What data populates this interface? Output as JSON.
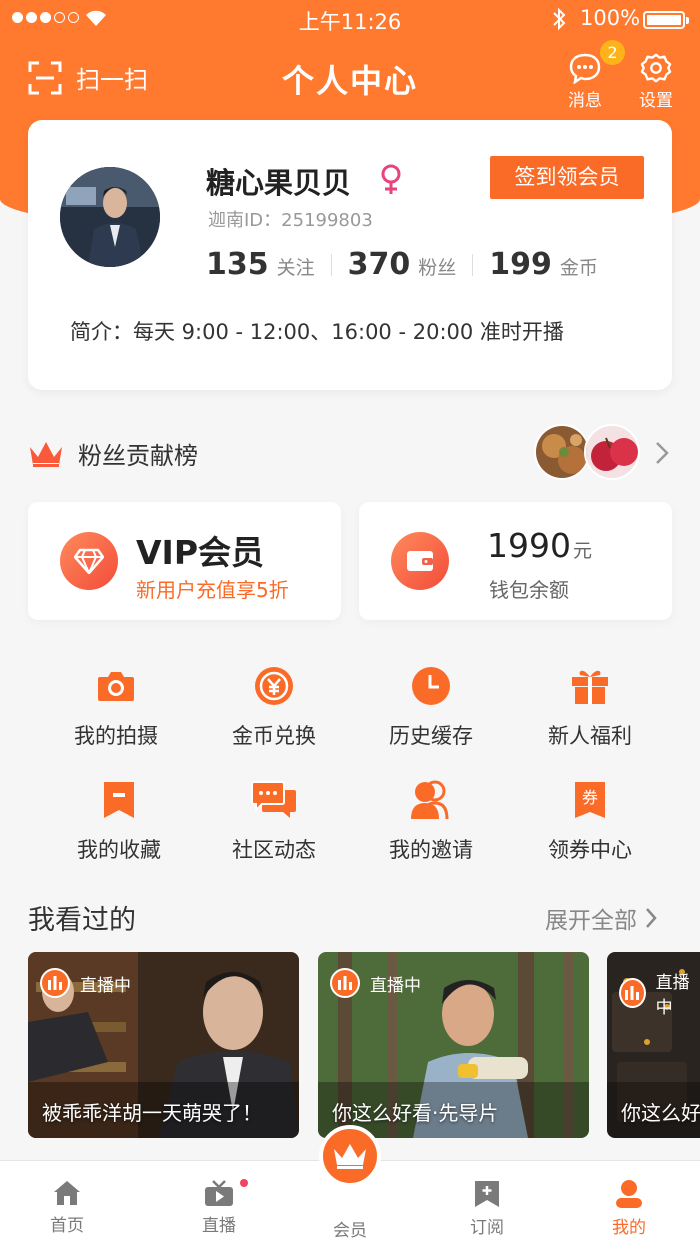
{
  "status_bar": {
    "time": "上午11:26",
    "battery": "100%"
  },
  "header": {
    "scan_label": "扫一扫",
    "title": "个人中心",
    "messages_label": "消息",
    "messages_badge": "2",
    "settings_label": "设置"
  },
  "profile": {
    "name": "糖心果贝贝",
    "checkin_label": "签到领会员",
    "id_text": "迦南ID：25199803",
    "following_count": "135",
    "following_label": "关注",
    "fans_count": "370",
    "fans_label": "粉丝",
    "coins_count": "199",
    "coins_label": "金币",
    "intro": "简介：每天 9:00 - 12:00、16:00 - 20:00 准时开播"
  },
  "fans_rank": {
    "title": "粉丝贡献榜"
  },
  "vip": {
    "title": "VIP会员",
    "subtitle": "新用户充值享5折"
  },
  "wallet": {
    "amount": "1990",
    "unit": "元",
    "subtitle": "钱包余额"
  },
  "grid": [
    {
      "label": "我的拍摄",
      "icon": "camera-icon"
    },
    {
      "label": "金币兑换",
      "icon": "coin-exchange-icon"
    },
    {
      "label": "历史缓存",
      "icon": "clock-icon"
    },
    {
      "label": "新人福利",
      "icon": "gift-icon"
    },
    {
      "label": "我的收藏",
      "icon": "bookmark-icon"
    },
    {
      "label": "社区动态",
      "icon": "chat-icon"
    },
    {
      "label": "我的邀请",
      "icon": "invite-icon"
    },
    {
      "label": "领券中心",
      "icon": "coupon-icon"
    }
  ],
  "history": {
    "title": "我看过的",
    "expand_label": "展开全部",
    "cards": [
      {
        "tag": "直播中",
        "caption": "被乖乖洋胡一天萌哭了！"
      },
      {
        "tag": "直播中",
        "caption": "你这么好看·先导片"
      },
      {
        "tag": "直播中",
        "caption": "你这么好看"
      }
    ]
  },
  "tabbar": {
    "home": "首页",
    "live": "直播",
    "member": "会员",
    "subscribe": "订阅",
    "mine": "我的"
  },
  "colors": {
    "accent": "#fb6b28",
    "header_bg": "#ff7a2f",
    "badge": "#ffb31a"
  }
}
